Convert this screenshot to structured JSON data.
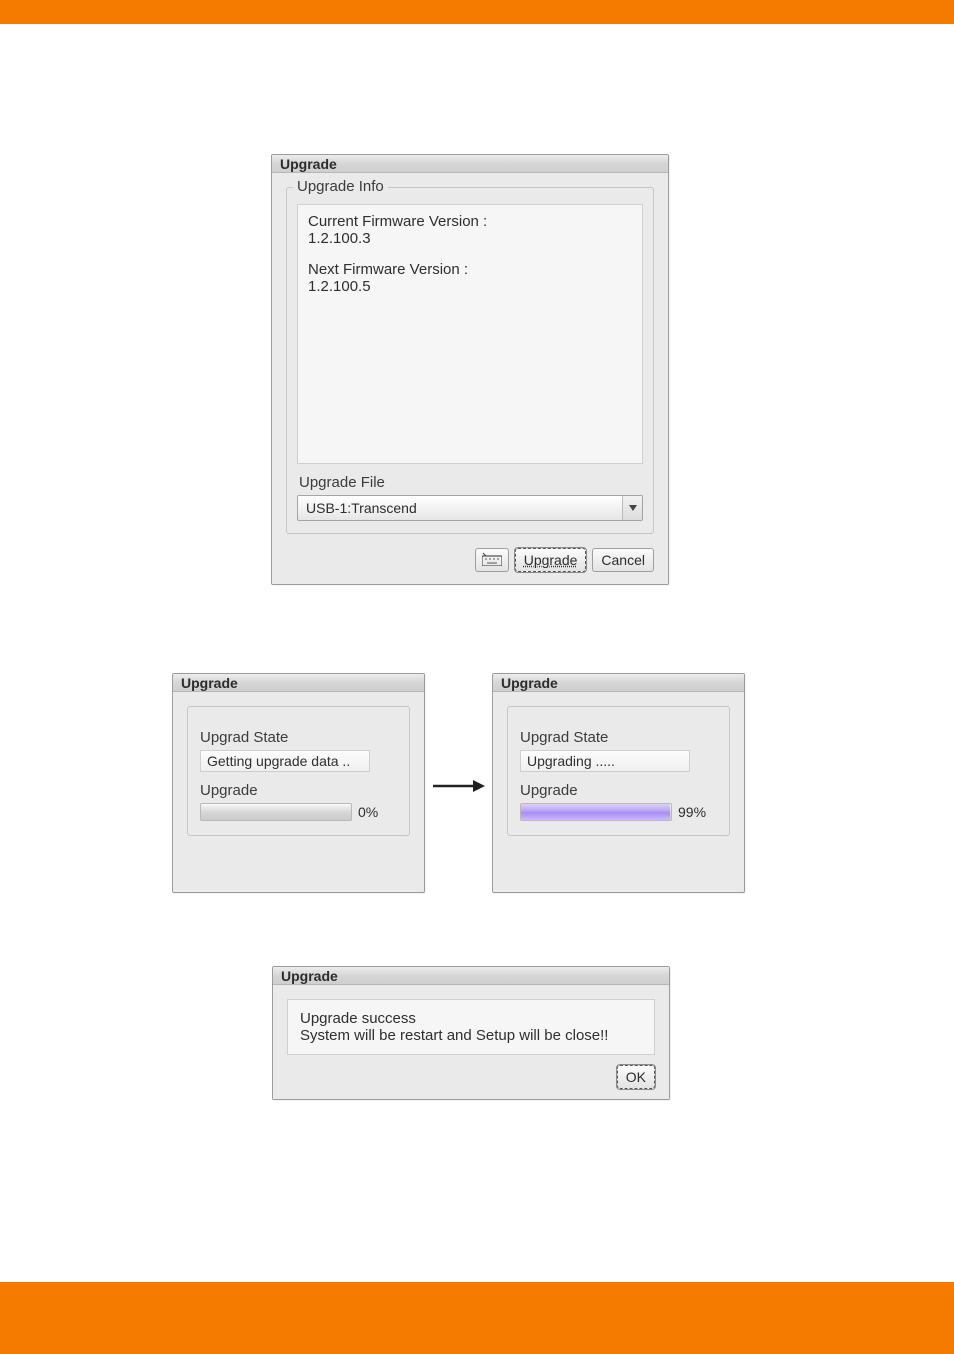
{
  "dialog_main": {
    "title": "Upgrade",
    "info": {
      "legend": "Upgrade Info",
      "line1": "Current Firmware Version :",
      "value1": "1.2.100.3",
      "line2": "Next Firmware Version :",
      "value2": "1.2.100.5"
    },
    "file": {
      "label": "Upgrade File",
      "value": "USB-1:Transcend"
    },
    "buttons": {
      "keyboard_icon": "keyboard-icon",
      "upgrade": "Upgrade",
      "cancel": "Cancel"
    }
  },
  "progress_left": {
    "title": "Upgrade",
    "state_label": "Upgrad State",
    "state_value": "Getting upgrade data ..",
    "progress_label": "Upgrade",
    "progress_pct": "0%",
    "progress_fill_pct": 0
  },
  "progress_right": {
    "title": "Upgrade",
    "state_label": "Upgrad State",
    "state_value": "Upgrading .....",
    "progress_label": "Upgrade",
    "progress_pct": "99%",
    "progress_fill_pct": 99
  },
  "dialog_done": {
    "title": "Upgrade",
    "msg1": "Upgrade success",
    "msg2": "System will be restart and Setup will be close!!",
    "ok": "OK"
  }
}
